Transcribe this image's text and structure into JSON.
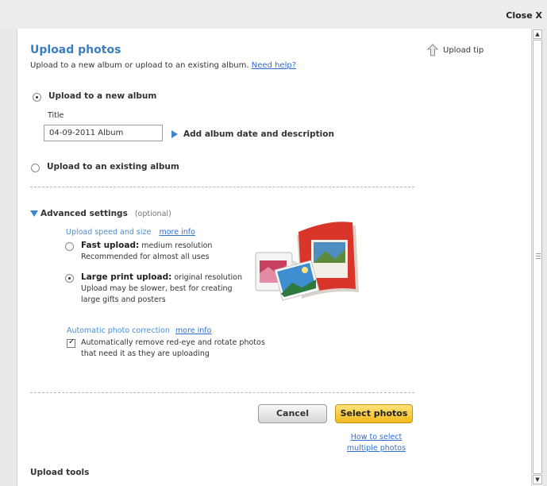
{
  "window": {
    "close_label": "Close X"
  },
  "header": {
    "title": "Upload photos",
    "subtitle": "Upload to a new album or upload to an existing album.",
    "help_link": "Need help?",
    "tip_label": "Upload tip"
  },
  "new_album": {
    "option_label": "Upload to a new album",
    "title_label": "Title",
    "title_value": "04-09-2011 Album",
    "add_details_label": "Add album date and description"
  },
  "existing_album": {
    "option_label": "Upload to an existing album"
  },
  "advanced": {
    "heading": "Advanced settings",
    "optional": "(optional)",
    "speed_label": "Upload speed and size",
    "more_info_1": "more info",
    "fast": {
      "title": "Fast upload:",
      "desc1": "medium resolution",
      "desc2": "Recommended for almost all uses"
    },
    "large": {
      "title": "Large print upload:",
      "desc1": "original resolution",
      "desc2": "Upload may be slower, best for creating",
      "desc3": "large gifts and posters"
    },
    "correction_label": "Automatic photo correction",
    "more_info_2": "more info",
    "auto_fix_line1": "Automatically remove red-eye and rotate photos",
    "auto_fix_line2": "that need it as they are uploading",
    "auto_fix_checked": true
  },
  "actions": {
    "cancel_label": "Cancel",
    "select_label": "Select photos",
    "howto_line1": "How to select",
    "howto_line2": "multiple photos"
  },
  "footer": {
    "tools_label": "Upload tools"
  },
  "colors": {
    "accent": "#3a7fc4",
    "link": "#2f6fd0",
    "primary_button": "#f6c531"
  }
}
